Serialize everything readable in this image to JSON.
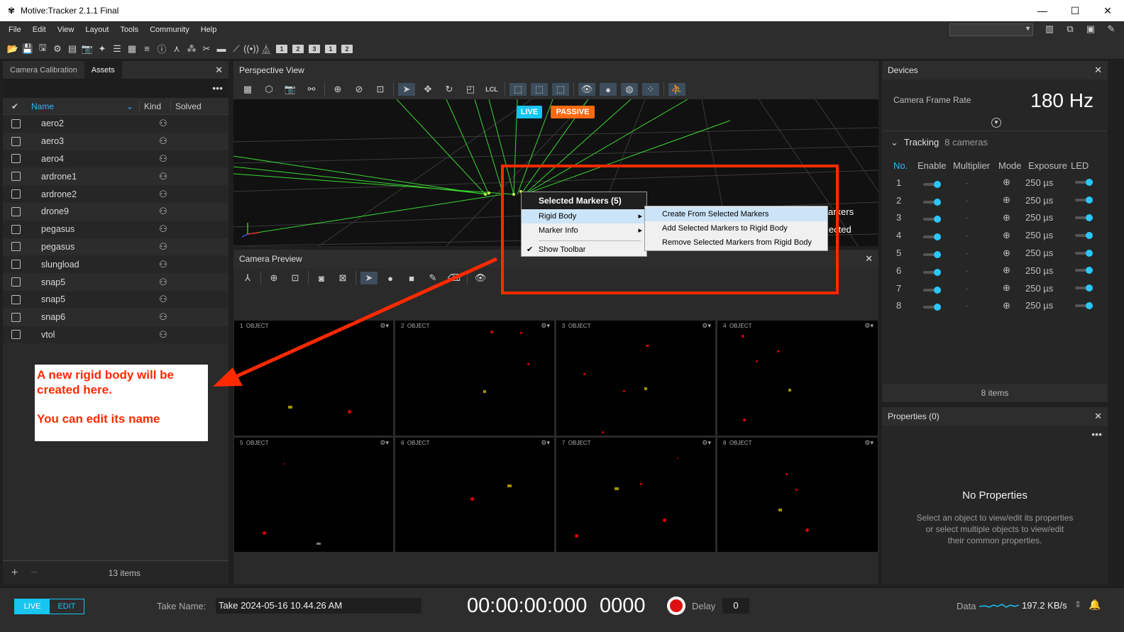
{
  "window": {
    "title": "Motive:Tracker 2.1.1 Final",
    "minimize": "—",
    "maximize": "☐",
    "close": "✕"
  },
  "menu": [
    "File",
    "Edit",
    "View",
    "Layout",
    "Tools",
    "Community",
    "Help"
  ],
  "toolbar_numbers": [
    "1",
    "2",
    "3",
    "1",
    "2"
  ],
  "assets_panel": {
    "tabs": [
      "Camera Calibration",
      "Assets"
    ],
    "columns": {
      "name": "Name",
      "kind": "Kind",
      "solved": "Solved"
    },
    "items": [
      "aero2",
      "aero3",
      "aero4",
      "ardrone1",
      "ardrone2",
      "drone9",
      "pegasus",
      "pegasus",
      "slungload",
      "snap5",
      "snap5",
      "snap6",
      "vtol"
    ],
    "footer_count": "13 items"
  },
  "annotation": {
    "line1": "A new rigid body will be",
    "line2": "created here.",
    "line3": "You can edit its name",
    "color": "#ff2a00"
  },
  "perspective": {
    "title": "Perspective View",
    "lcl": "LCL",
    "live_badge": "LIVE",
    "passive_badge": "PASSIVE",
    "overlay_text1": "arkers",
    "overlay_text2": "lected"
  },
  "context_menu": {
    "header": "Selected Markers (5)",
    "items": [
      "Rigid Body",
      "Marker Info",
      "Show Toolbar"
    ],
    "submenu": [
      "Create From Selected Markers",
      "Add Selected Markers to Rigid Body",
      "Remove Selected Markers from Rigid Body"
    ]
  },
  "camera_preview": {
    "title": "Camera Preview",
    "cells": [
      {
        "num": "1",
        "label": "OBJECT"
      },
      {
        "num": "2",
        "label": "OBJECT"
      },
      {
        "num": "3",
        "label": "OBJECT"
      },
      {
        "num": "4",
        "label": "OBJECT"
      },
      {
        "num": "5",
        "label": "OBJECT"
      },
      {
        "num": "6",
        "label": "OBJECT"
      },
      {
        "num": "7",
        "label": "OBJECT"
      },
      {
        "num": "8",
        "label": "OBJECT"
      }
    ]
  },
  "devices": {
    "title": "Devices",
    "frame_rate_label": "Camera Frame Rate",
    "frame_rate_value": "180 Hz",
    "tracking_label": "Tracking",
    "tracking_count": "8 cameras",
    "columns": [
      "No.",
      "Enable",
      "Multiplier",
      "Mode",
      "Exposure",
      "LED"
    ],
    "rows": [
      {
        "no": "1",
        "multiplier": "-",
        "exposure": "250 µs"
      },
      {
        "no": "2",
        "multiplier": "-",
        "exposure": "250 µs"
      },
      {
        "no": "3",
        "multiplier": "-",
        "exposure": "250 µs"
      },
      {
        "no": "4",
        "multiplier": "-",
        "exposure": "250 µs"
      },
      {
        "no": "5",
        "multiplier": "-",
        "exposure": "250 µs"
      },
      {
        "no": "6",
        "multiplier": "-",
        "exposure": "250 µs"
      },
      {
        "no": "7",
        "multiplier": "-",
        "exposure": "250 µs"
      },
      {
        "no": "8",
        "multiplier": "-",
        "exposure": "250 µs"
      }
    ],
    "footer": "8 items"
  },
  "properties": {
    "title": "Properties (0)",
    "empty_title": "No Properties",
    "empty_line1": "Select an object to view/edit its properties",
    "empty_line2": "or select multiple objects to view/edit",
    "empty_line3": "their common properties."
  },
  "bottom": {
    "live": "LIVE",
    "edit": "EDIT",
    "take_label": "Take Name:",
    "take_value": "Take 2024-05-16 10.44.26 AM",
    "timecode": "00:00:00:000",
    "frame": "0000",
    "delay_label": "Delay",
    "delay_value": "0",
    "data_label": "Data",
    "data_rate": "197.2 KB/s"
  },
  "colors": {
    "accent": "#2fb6ff",
    "live": "#17c5f0",
    "passive": "#ff6a13",
    "record": "#e01010",
    "highlight_box": "#ff2a00"
  }
}
